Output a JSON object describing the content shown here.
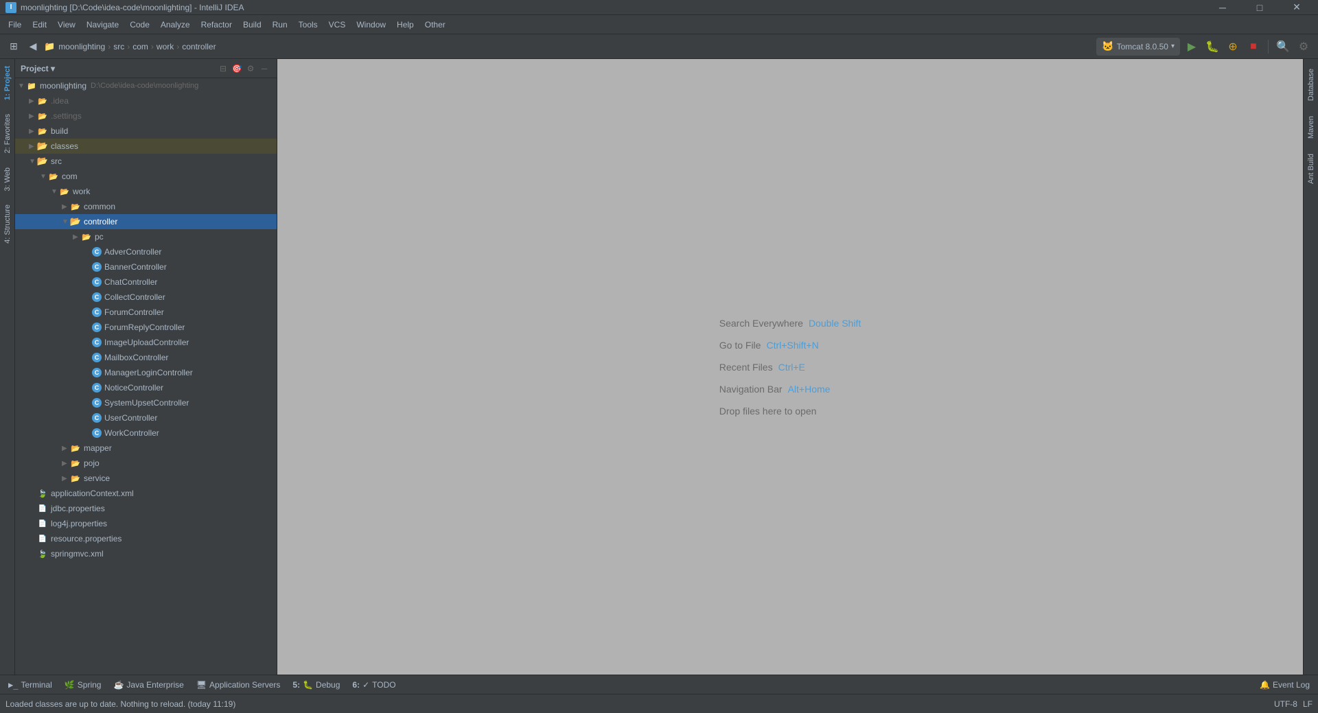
{
  "window": {
    "title": "moonlighting [D:\\Code\\idea-code\\moonlighting] - IntelliJ IDEA",
    "icon": "I"
  },
  "titlebar": {
    "min_label": "─",
    "max_label": "□",
    "close_label": "✕"
  },
  "menubar": {
    "items": [
      "File",
      "Edit",
      "View",
      "Navigate",
      "Code",
      "Analyze",
      "Refactor",
      "Build",
      "Run",
      "Tools",
      "VCS",
      "Window",
      "Help",
      "Other"
    ]
  },
  "toolbar": {
    "breadcrumb": [
      "moonlighting",
      "src",
      "com",
      "work",
      "controller"
    ],
    "run_config": "Tomcat 8.0.50",
    "run_config_icon": "🐱"
  },
  "project_panel": {
    "title": "Project",
    "root": {
      "label": "moonlighting",
      "path": "D:\\Code\\idea-code\\moonlighting",
      "children": [
        {
          "id": "idea",
          "label": ".idea",
          "type": "folder-idea",
          "indent": 1
        },
        {
          "id": "settings",
          "label": ".settings",
          "type": "folder-settings",
          "indent": 1
        },
        {
          "id": "build",
          "label": "build",
          "type": "folder",
          "indent": 1
        },
        {
          "id": "classes",
          "label": "classes",
          "type": "folder-yellow",
          "indent": 1
        },
        {
          "id": "src",
          "label": "src",
          "type": "folder-src",
          "open": true,
          "indent": 1,
          "children": [
            {
              "id": "com",
              "label": "com",
              "type": "folder",
              "open": true,
              "indent": 2,
              "children": [
                {
                  "id": "work",
                  "label": "work",
                  "type": "folder",
                  "open": true,
                  "indent": 3,
                  "children": [
                    {
                      "id": "common",
                      "label": "common",
                      "type": "folder",
                      "indent": 4
                    },
                    {
                      "id": "controller",
                      "label": "controller",
                      "type": "folder-blue",
                      "open": true,
                      "selected": true,
                      "indent": 4,
                      "children": [
                        {
                          "id": "pc",
                          "label": "pc",
                          "type": "folder",
                          "indent": 5
                        },
                        {
                          "id": "AdverController",
                          "label": "AdverController",
                          "type": "class",
                          "indent": 5
                        },
                        {
                          "id": "BannerController",
                          "label": "BannerController",
                          "type": "class",
                          "indent": 5
                        },
                        {
                          "id": "ChatController",
                          "label": "ChatController",
                          "type": "class",
                          "indent": 5
                        },
                        {
                          "id": "CollectController",
                          "label": "CollectController",
                          "type": "class",
                          "indent": 5
                        },
                        {
                          "id": "ForumController",
                          "label": "ForumController",
                          "type": "class",
                          "indent": 5
                        },
                        {
                          "id": "ForumReplyController",
                          "label": "ForumReplyController",
                          "type": "class",
                          "indent": 5
                        },
                        {
                          "id": "ImageUploadController",
                          "label": "ImageUploadController",
                          "type": "class",
                          "indent": 5
                        },
                        {
                          "id": "MailboxController",
                          "label": "MailboxController",
                          "type": "class",
                          "indent": 5
                        },
                        {
                          "id": "ManagerLoginController",
                          "label": "ManagerLoginController",
                          "type": "class",
                          "indent": 5
                        },
                        {
                          "id": "NoticeController",
                          "label": "NoticeController",
                          "type": "class",
                          "indent": 5
                        },
                        {
                          "id": "SystemUpsetController",
                          "label": "SystemUpsetController",
                          "type": "class",
                          "indent": 5
                        },
                        {
                          "id": "UserController",
                          "label": "UserController",
                          "type": "class",
                          "indent": 5
                        },
                        {
                          "id": "WorkController",
                          "label": "WorkController",
                          "type": "class",
                          "indent": 5
                        }
                      ]
                    },
                    {
                      "id": "mapper",
                      "label": "mapper",
                      "type": "folder",
                      "indent": 4
                    },
                    {
                      "id": "pojo",
                      "label": "pojo",
                      "type": "folder",
                      "indent": 4
                    },
                    {
                      "id": "service",
                      "label": "service",
                      "type": "folder",
                      "indent": 4
                    }
                  ]
                }
              ]
            }
          ]
        },
        {
          "id": "applicationContext",
          "label": "applicationContext.xml",
          "type": "xml",
          "indent": 1
        },
        {
          "id": "jdbc",
          "label": "jdbc.properties",
          "type": "props",
          "indent": 1
        },
        {
          "id": "log4j",
          "label": "log4j.properties",
          "type": "props",
          "indent": 1
        },
        {
          "id": "resource",
          "label": "resource.properties",
          "type": "props",
          "indent": 1
        },
        {
          "id": "springmvc",
          "label": "springmvc.xml",
          "type": "xml",
          "indent": 1
        }
      ]
    }
  },
  "editor": {
    "hints": [
      {
        "text": "Search Everywhere",
        "shortcut": "Double Shift"
      },
      {
        "text": "Go to File",
        "shortcut": "Ctrl+Shift+N"
      },
      {
        "text": "Recent Files",
        "shortcut": "Ctrl+E"
      },
      {
        "text": "Navigation Bar",
        "shortcut": "Alt+Home"
      },
      {
        "text": "Drop files here to open",
        "shortcut": ""
      }
    ]
  },
  "right_tabs": [
    {
      "id": "database",
      "label": "Database"
    },
    {
      "id": "maven",
      "label": "Maven"
    },
    {
      "id": "ant-build",
      "label": "Ant Build"
    }
  ],
  "left_side_tabs": [
    {
      "id": "project",
      "label": "1: Project"
    },
    {
      "id": "favorites",
      "label": "2: Favorites"
    },
    {
      "id": "web",
      "label": "3: Web"
    },
    {
      "id": "structure",
      "label": "4: Structure"
    }
  ],
  "bottom_tabs": [
    {
      "id": "terminal",
      "label": "Terminal",
      "num": "",
      "icon": ">_"
    },
    {
      "id": "spring",
      "label": "Spring",
      "num": "",
      "icon": "🌿"
    },
    {
      "id": "java-enterprise",
      "label": "Java Enterprise",
      "num": "",
      "icon": "☕"
    },
    {
      "id": "app-servers",
      "label": "Application Servers",
      "num": "",
      "icon": "🖥"
    },
    {
      "id": "debug",
      "label": "Debug",
      "num": "5",
      "icon": "🐛"
    },
    {
      "id": "todo",
      "label": "TODO",
      "num": "6",
      "icon": "✓"
    }
  ],
  "statusbar": {
    "message": "Loaded classes are up to date. Nothing to reload. (today 11:19)",
    "right_items": [
      "Event Log"
    ]
  }
}
